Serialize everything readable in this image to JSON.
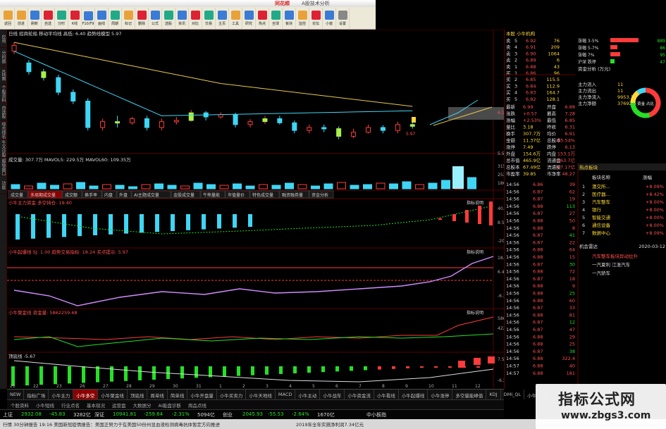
{
  "toolbar": {
    "brand": "同花顺",
    "app_name": "A股技术分析",
    "buttons": [
      "返回",
      "前进",
      "刷新",
      "自选",
      "分时",
      "K线",
      "F10/F9",
      "画线",
      "周期",
      "标记",
      "删除",
      "公式",
      "选股",
      "资讯",
      "对比",
      "交易",
      "主页",
      "工具",
      "研究",
      "热点",
      "全球",
      "板块",
      "监控",
      "论坛",
      "小窗",
      "设置"
    ]
  },
  "rail": [
    "应用",
    "分时图",
    "K线图",
    "个股资料",
    "自选股",
    "综合排名",
    "牛叉诊股",
    "超级盘口",
    "功能"
  ],
  "chart": {
    "header": "日线  招商轮船  移动平均线  高低: 6.40  趋势线模型  5.97",
    "price_labels": [
      "6.13",
      "6.40",
      "5.53"
    ],
    "annotation": "5.97",
    "volume_header": "成交量: 307.7万  MAVOL5: 229.5万  MAVOL60: 109.35万",
    "volume_labels": [
      "3157",
      "2523",
      "1868"
    ],
    "vol_tabs": [
      "成交量",
      "多周期成交量",
      "成交额",
      "换手率",
      "内盘",
      "外盘",
      "AI主题成交量",
      "金股成交量",
      "牛熊量能",
      "市值量价",
      "特色成交量",
      "融资融券量",
      "资金分析"
    ],
    "ind1_header": "小牛主力资金 多空持仓: 19.40",
    "ind1_right": "指标说明",
    "ind1_labels": [
      "40.25",
      "8.52",
      "-20.65"
    ],
    "ind2_header": "小牛起爆线 SJ: 1.00  趋势交易指标: 18.24  买点提示: 5.97",
    "ind2_right": "指标说明",
    "ind2_labels": [
      "18.24",
      "6.43",
      "-6.38"
    ],
    "ind3_header": "小牛聚金线  资金量: 5862259.68",
    "ind3_right": "指标说明",
    "ind3_labels": [
      "5862259",
      "4225"
    ],
    "ind4_header": "顶底线 -5.67",
    "ind4_labels": [
      "7.52",
      "-6.21"
    ],
    "dates": [
      "21",
      "22",
      "23",
      "26",
      "27",
      "28",
      "29",
      "30",
      "31",
      "1",
      "2",
      "3",
      "4",
      "5",
      "6",
      "7",
      "8",
      "9",
      "10",
      "11",
      "12"
    ]
  },
  "tabs": [
    "NEW",
    "指标广场",
    "小牛主力",
    "小牛多空",
    "小牛聚金线",
    "顶底线",
    "周单线",
    "简单线",
    "小牛开盘量",
    "小牛买卖力",
    "小牛天地线",
    "MACD",
    "小牛主动",
    "小牛战车",
    "小牛资金流",
    "小牛看线",
    "小牛起爆线",
    "小牛涨停",
    "多空量能峰值",
    "KDJ",
    "DMI_QL",
    "小牛 …"
  ],
  "tabs2": [
    "个股资料",
    "小牛短线",
    "行业点名",
    "基本现况",
    "运营盘",
    "大数据分",
    "AI能盘诊断",
    "周品点线"
  ],
  "status": {
    "items": [
      "上证",
      "2932.08",
      "-45.83",
      "3282亿",
      "深证",
      "10941.81",
      "-259.64",
      "-2.31%",
      "5094亿",
      "创业",
      "2045.93",
      "-55.53",
      "-2.64%",
      "1670亿",
      "中小板指"
    ],
    "news": "行情  30分钟报告  19:16 美国新冠疫情报告：美国正努力于在美国50份州显血液检测病毒抗体暂定方向推进",
    "ticker": "2019年全年实施净利润7.34亿元"
  },
  "side": {
    "stock_title": "本股 小牛机构",
    "asks": [
      {
        "lvl": "5",
        "price": "6.92",
        "vol": "76"
      },
      {
        "lvl": "4",
        "price": "6.91",
        "vol": "209"
      },
      {
        "lvl": "3",
        "price": "6.90",
        "vol": "1064"
      },
      {
        "lvl": "2",
        "price": "6.89",
        "vol": "6"
      },
      {
        "lvl": "1",
        "price": "6.88",
        "vol": "43"
      }
    ],
    "bids": [
      {
        "lvl": "1",
        "price": "6.86",
        "vol": "96"
      },
      {
        "lvl": "2",
        "price": "6.85",
        "vol": "115.5"
      },
      {
        "lvl": "3",
        "price": "6.84",
        "vol": "112.9"
      },
      {
        "lvl": "4",
        "price": "6.83",
        "vol": "164.7"
      },
      {
        "lvl": "5",
        "price": "6.82",
        "vol": "128.1"
      }
    ],
    "stats": [
      {
        "k": "最新",
        "v": "6.99",
        "k2": "开盘",
        "v2": "6.88"
      },
      {
        "k": "涨跌",
        "v": "+0.57",
        "k2": "最高",
        "v2": "7.28"
      },
      {
        "k": "涨幅",
        "v": "+2.53%",
        "k2": "最低",
        "v2": "6.85"
      },
      {
        "k": "量比",
        "v": "3.18",
        "k2": "昨收",
        "v2": "6.31"
      },
      {
        "k": "换手",
        "v": "307.7万",
        "k2": "均价",
        "v2": "6.91"
      },
      {
        "k": "金额",
        "v": "11.37亿",
        "k2": "总股本",
        "v2": "65.54%"
      },
      {
        "k": "涨停",
        "v": "7.49",
        "k2": "跌停",
        "v2": "6.13"
      },
      {
        "k": "外盘",
        "v": "154.6万",
        "k2": "内盘",
        "v2": "153.1万"
      },
      {
        "k": "总市值",
        "v": "465.9亿",
        "k2": "流通盘",
        "v2": "463.7亿"
      },
      {
        "k": "总股本",
        "v": "67.49亿",
        "k2": "流通股",
        "v2": "67.17亿"
      },
      {
        "k": "市盈率",
        "v": "39.85",
        "k2": "市净率",
        "v2": "48.27"
      }
    ],
    "trades": [
      "14:56",
      "14:56",
      "14:56",
      "14:56",
      "14:56",
      "14:56",
      "14:56",
      "14:56",
      "14:56",
      "14:56",
      "14:56",
      "14:56",
      "14:56",
      "14:56",
      "14:56",
      "14:56",
      "14:56",
      "14:56",
      "14:56",
      "14:56",
      "14:56",
      "14:56",
      "14:56",
      "14:56",
      "14:56",
      "14:57",
      "14:57"
    ],
    "trade_prices": [
      "6.86",
      "6.87",
      "6.87",
      "6.88",
      "6.87",
      "6.88",
      "6.88",
      "6.87",
      "6.87",
      "6.88",
      "6.88",
      "6.87",
      "6.88",
      "6.87",
      "6.88",
      "6.88",
      "6.88",
      "6.87",
      "6.88",
      "6.87",
      "6.87",
      "6.88",
      "6.88",
      "6.87",
      "6.88",
      "6.88",
      "6.88"
    ],
    "trade_vols": [
      "39",
      "62",
      "19",
      "113",
      "27",
      "50",
      "8",
      "41",
      "22",
      "64",
      "15",
      "30",
      "72",
      "18",
      "9",
      "25",
      "60",
      "33",
      "81",
      "12",
      "47",
      "29",
      "25",
      "38",
      "322.4",
      "40",
      "181"
    ],
    "limit_labels": [
      "涨幅 3-5%",
      "涨幅 5-7%",
      "涨幅 7%",
      "沪深 跌停"
    ],
    "limit_vals": [
      "889",
      "86",
      "95",
      "47"
    ],
    "capital_header": "资金分析 (万元)",
    "capital": [
      {
        "k": "主力流入",
        "v": "11"
      },
      {
        "k": "主力流出",
        "v": "11"
      },
      {
        "k": "主力净流入",
        "v": "9953.1"
      },
      {
        "k": "主力净额",
        "v": "37692.5"
      }
    ],
    "hot_header": "热点板块",
    "hot_cols": [
      "板块名称",
      "涨幅"
    ],
    "hot": [
      {
        "n": "1",
        "name": "澳交所...",
        "v": "+8.09%"
      },
      {
        "n": "2",
        "name": "医疗器...",
        "v": "+8.42%"
      },
      {
        "n": "3",
        "name": "汽车整车",
        "v": "+8.00%"
      },
      {
        "n": "4",
        "name": "银行",
        "v": "+8.00%"
      },
      {
        "n": "5",
        "name": "智能交通",
        "v": "+8.00%"
      },
      {
        "n": "6",
        "name": "通信设备",
        "v": "+8.00%"
      },
      {
        "n": "7",
        "name": "数据中心",
        "v": "+8.09%"
      }
    ],
    "date_tag": "2020-03-12",
    "news_items": [
      "汽车整车板块异动拉升",
      "一汽夏利 江淮汽车",
      "一汽轿车"
    ],
    "donut_label": "资金 占比"
  }
}
